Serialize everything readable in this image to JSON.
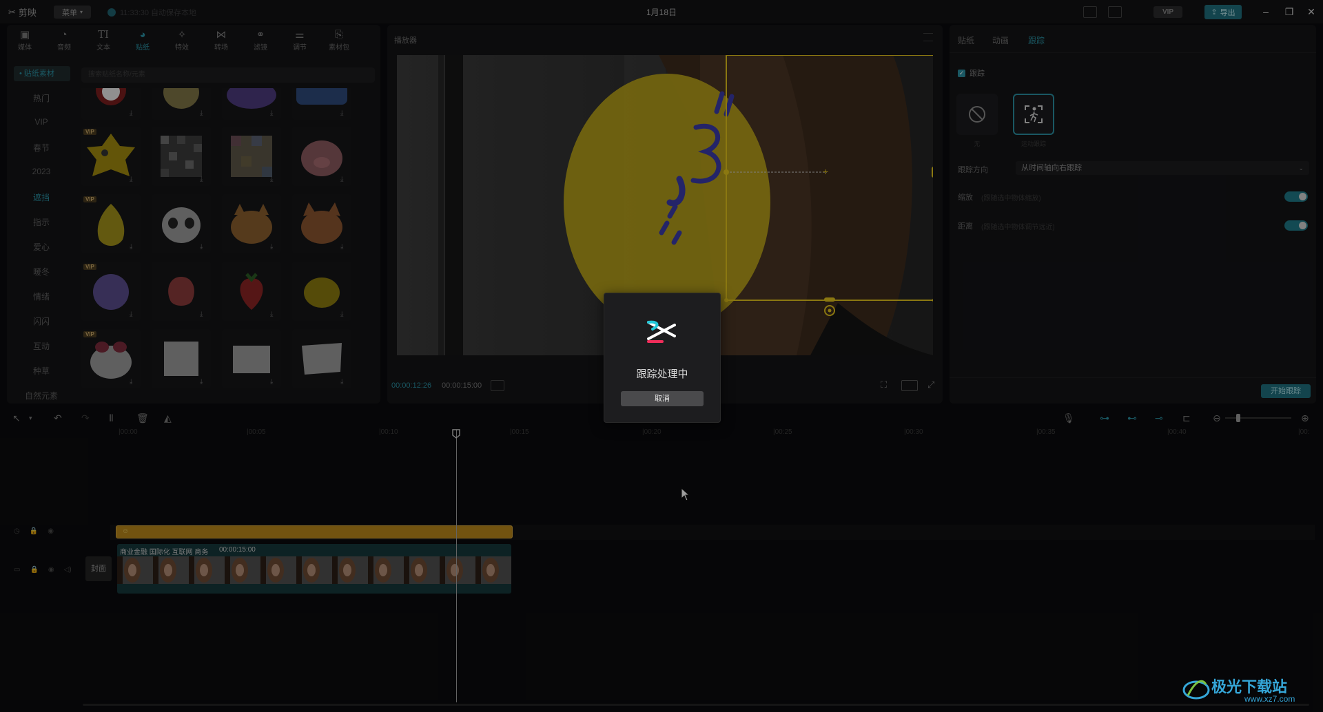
{
  "titlebar": {
    "app_name": "剪映",
    "menu_label": "菜单",
    "autosave": "11:33:30 自动保存本地",
    "doc_title": "1月18日",
    "vip": "VIP",
    "export_label": "导出"
  },
  "tool_tabs": [
    {
      "label": "媒体",
      "icon": "media-icon"
    },
    {
      "label": "音频",
      "icon": "audio-icon"
    },
    {
      "label": "文本",
      "icon": "text-icon"
    },
    {
      "label": "贴纸",
      "icon": "sticker-icon"
    },
    {
      "label": "特效",
      "icon": "effects-icon"
    },
    {
      "label": "转场",
      "icon": "transition-icon"
    },
    {
      "label": "滤镜",
      "icon": "filter-icon"
    },
    {
      "label": "调节",
      "icon": "adjust-icon"
    },
    {
      "label": "素材包",
      "icon": "package-icon"
    }
  ],
  "sticker_panel": {
    "selected_category": "• 贴纸素材",
    "search_placeholder": "搜索贴纸名称/元素",
    "categories": [
      "热门",
      "VIP",
      "春节",
      "2023",
      "遮挡",
      "指示",
      "爱心",
      "暖冬",
      "情绪",
      "闪闪",
      "互动",
      "种草",
      "自然元素"
    ],
    "active_category": "遮挡"
  },
  "player": {
    "title": "播放器",
    "time_current": "00:00:12:26",
    "time_total": "00:00:15:00"
  },
  "right_panel": {
    "tabs": [
      "贴纸",
      "动画",
      "跟踪"
    ],
    "active_tab": "跟踪",
    "tracking_label": "跟踪",
    "mode_none": "无",
    "mode_motion": "运动跟踪",
    "direction_label": "跟踪方向",
    "direction_value": "从时间轴向右跟踪",
    "scale_label": "缩放",
    "scale_hint": "(跟随选中物体缩放)",
    "distance_label": "距离",
    "distance_hint": "(跟随选中物体调节远近)",
    "start_button": "开始跟踪"
  },
  "timeline": {
    "ticks": [
      "|00:00",
      "|00:05",
      "|00:10",
      "|00:15",
      "|00:20",
      "|00:25",
      "|00:30",
      "|00:35",
      "|00:40",
      "|00:"
    ],
    "cover_label": "封面",
    "clip_title": "商业金融 国际化 互联网 商务",
    "clip_duration": "00:00:15:00"
  },
  "modal": {
    "message": "跟踪处理中",
    "cancel_label": "取消"
  },
  "watermark": {
    "brand": "极光下载站",
    "url": "www.xz7.com"
  },
  "colors": {
    "accent": "#2a8fa0",
    "sticker_yellow": "#b8a21a",
    "clip_gold": "#b8871b"
  }
}
